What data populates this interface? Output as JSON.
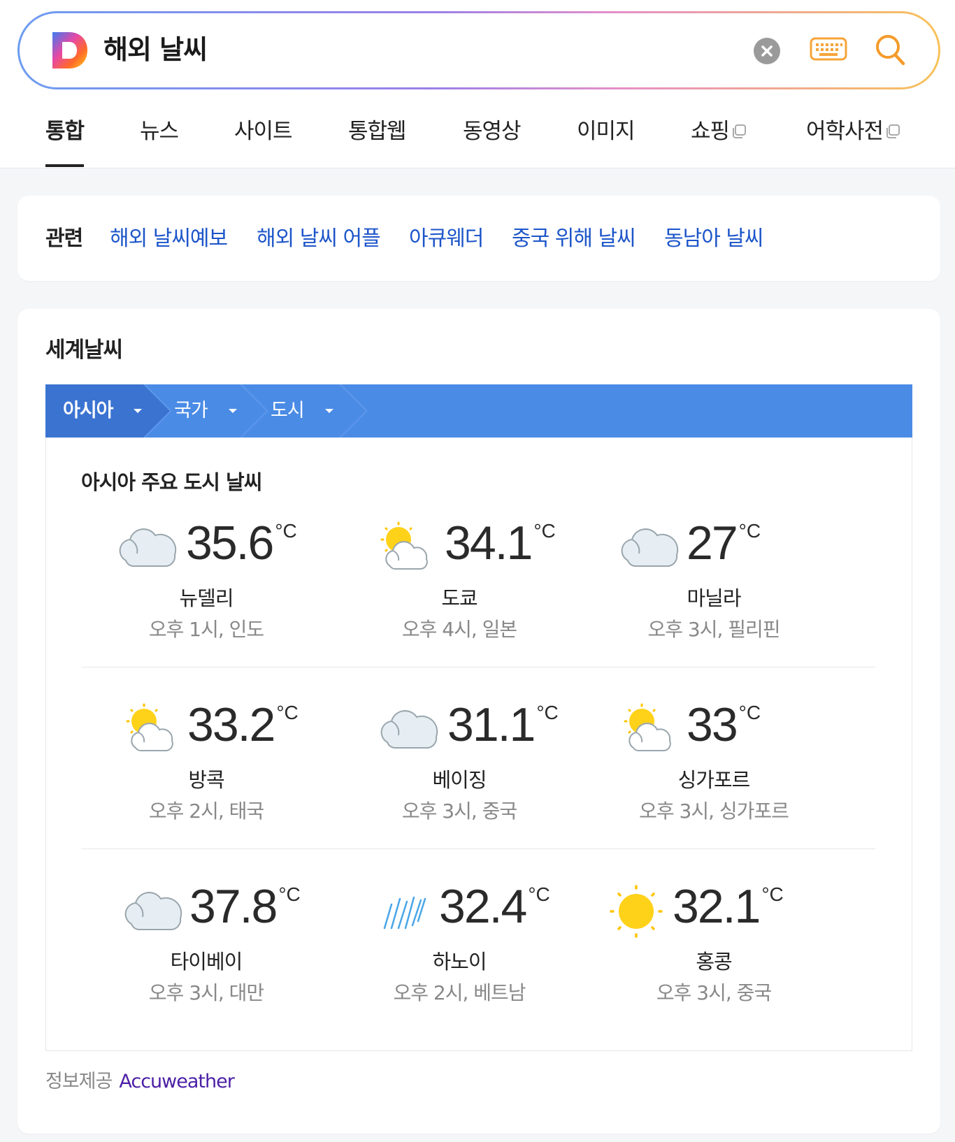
{
  "search": {
    "query": "해외 날씨",
    "logo_icon": "daum-logo-icon",
    "clear_icon": "clear-icon",
    "keyboard_icon": "keyboard-icon",
    "search_icon": "search-icon"
  },
  "tabs": [
    {
      "label": "통합",
      "active": true
    },
    {
      "label": "뉴스"
    },
    {
      "label": "사이트"
    },
    {
      "label": "통합웹"
    },
    {
      "label": "동영상"
    },
    {
      "label": "이미지"
    },
    {
      "label": "쇼핑",
      "external": true
    },
    {
      "label": "어학사전",
      "external": true
    }
  ],
  "related": {
    "label": "관련",
    "links": [
      "해외 날씨예보",
      "해외 날씨 어플",
      "아큐웨더",
      "중국 위해 날씨",
      "동남아 날씨"
    ]
  },
  "weather": {
    "title": "세계날씨",
    "breadcrumb": [
      {
        "label": "아시아"
      },
      {
        "label": "국가"
      },
      {
        "label": "도시"
      }
    ],
    "panel_title": "아시아 주요 도시 날씨",
    "unit": "°C",
    "cities": [
      {
        "name": "뉴델리",
        "temp": "35.6",
        "meta": "오후 1시, 인도",
        "icon": "cloudy-icon"
      },
      {
        "name": "도쿄",
        "temp": "34.1",
        "meta": "오후 4시, 일본",
        "icon": "partly-sunny-icon"
      },
      {
        "name": "마닐라",
        "temp": "27",
        "meta": "오후 3시, 필리핀",
        "icon": "cloudy-icon"
      },
      {
        "name": "방콕",
        "temp": "33.2",
        "meta": "오후 2시, 태국",
        "icon": "partly-sunny-icon"
      },
      {
        "name": "베이징",
        "temp": "31.1",
        "meta": "오후 3시, 중국",
        "icon": "cloudy-icon"
      },
      {
        "name": "싱가포르",
        "temp": "33",
        "meta": "오후 3시, 싱가포르",
        "icon": "partly-sunny-icon"
      },
      {
        "name": "타이베이",
        "temp": "37.8",
        "meta": "오후 3시, 대만",
        "icon": "cloudy-icon"
      },
      {
        "name": "하노이",
        "temp": "32.4",
        "meta": "오후 2시, 베트남",
        "icon": "rain-icon"
      },
      {
        "name": "홍콩",
        "temp": "32.1",
        "meta": "오후 3시, 중국",
        "icon": "sunny-icon"
      }
    ],
    "source_label": "정보제공",
    "source_link": "Accuweather"
  },
  "colors": {
    "accent_blue": "#4a8be6",
    "link_blue": "#1c55c9",
    "source_purple": "#4b1fa6",
    "sun_yellow": "#ffd21a",
    "cloud_fill": "#e6eef3"
  }
}
